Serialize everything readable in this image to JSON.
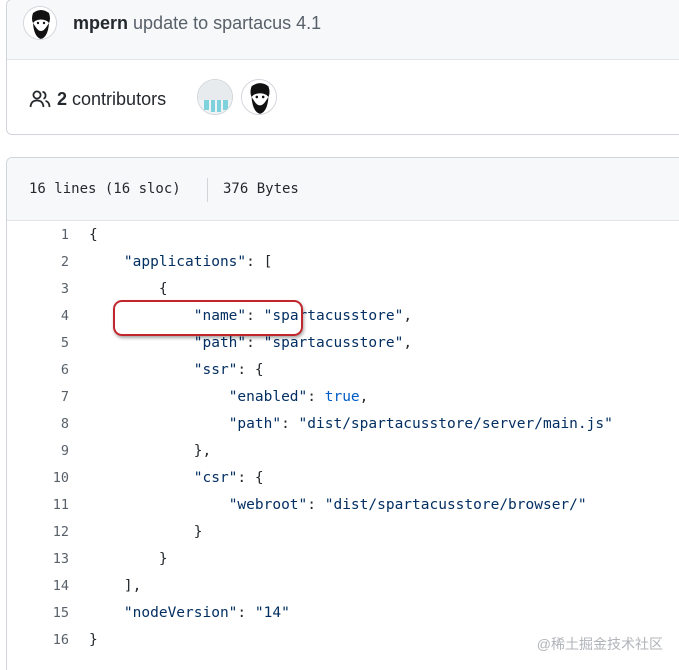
{
  "commit": {
    "author": "mpern",
    "message": "update to spartacus 4.1"
  },
  "contributors": {
    "count": "2",
    "label": "contributors"
  },
  "file": {
    "lines_info": "16 lines (16 sloc)",
    "size": "376 Bytes"
  },
  "code_lines": [
    {
      "num": "1"
    },
    {
      "num": "2"
    },
    {
      "num": "3"
    },
    {
      "num": "4"
    },
    {
      "num": "5"
    },
    {
      "num": "6"
    },
    {
      "num": "7"
    },
    {
      "num": "8"
    },
    {
      "num": "9"
    },
    {
      "num": "10"
    },
    {
      "num": "11"
    },
    {
      "num": "12"
    },
    {
      "num": "13"
    },
    {
      "num": "14"
    },
    {
      "num": "15"
    },
    {
      "num": "16"
    }
  ],
  "code": {
    "l1": "{",
    "l2_key": "\"applications\"",
    "l2_rest": ": [",
    "l3": "{",
    "l4_key": "\"name\"",
    "l4_sep": ": ",
    "l4_val": "\"spartacusstore\"",
    "l4_end": ",",
    "l5_key": "\"path\"",
    "l5_sep": ": ",
    "l5_val": "\"spartacusstore\"",
    "l5_end": ",",
    "l6_key": "\"ssr\"",
    "l6_rest": ": {",
    "l7_key": "\"enabled\"",
    "l7_sep": ": ",
    "l7_val": "true",
    "l7_end": ",",
    "l8_key": "\"path\"",
    "l8_sep": ": ",
    "l8_val": "\"dist/spartacusstore/server/main.js\"",
    "l9": "},",
    "l10_key": "\"csr\"",
    "l10_rest": ": {",
    "l11_key": "\"webroot\"",
    "l11_sep": ": ",
    "l11_val": "\"dist/spartacusstore/browser/\"",
    "l12": "}",
    "l13": "}",
    "l14": "],",
    "l15_key": "\"nodeVersion\"",
    "l15_sep": ": ",
    "l15_val": "\"14\"",
    "l16": "}"
  },
  "watermark": "@稀土掘金技术社区",
  "icons": {
    "people": "people-icon",
    "avatar_author": "bearded-face-avatar",
    "avatar_contributor": "identicon-avatar"
  },
  "colors": {
    "header_bg": "#f6f8fa",
    "string": "#032f62",
    "keyword": "#005cc5",
    "highlight": "#c0262c"
  }
}
